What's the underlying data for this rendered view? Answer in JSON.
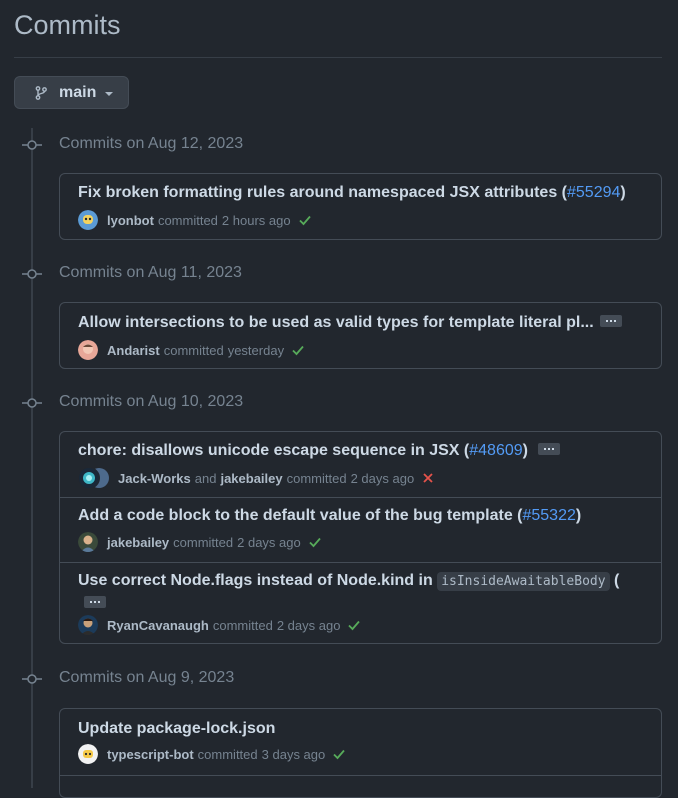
{
  "page": {
    "title": "Commits"
  },
  "branch": {
    "name": "main"
  },
  "groups": [
    {
      "date_label": "Commits on Aug 12, 2023",
      "commits": [
        {
          "message": "Fix broken formatting rules around namespaced JSX attributes (",
          "pr": "#55294",
          "message_end": ")",
          "author": "lyonbot",
          "verb": "committed",
          "time": "2 hours ago",
          "status": "success"
        }
      ]
    },
    {
      "date_label": "Commits on Aug 11, 2023",
      "commits": [
        {
          "message": "Allow intersections to be used as valid types for template literal pl...",
          "author": "Andarist",
          "verb": "committed",
          "time": "yesterday",
          "status": "success"
        }
      ]
    },
    {
      "date_label": "Commits on Aug 10, 2023",
      "commits": [
        {
          "message": "chore: disallows unicode escape sequence in JSX (",
          "pr": "#48609",
          "message_end": ")",
          "author": "Jack-Works",
          "conj": "and",
          "coauthor": "jakebailey",
          "verb": "committed",
          "time": "2 days ago",
          "status": "failure"
        },
        {
          "message": "Add a code block to the default value of the bug template (",
          "pr": "#55322",
          "message_end": ")",
          "author": "jakebailey",
          "verb": "committed",
          "time": "2 days ago",
          "status": "success"
        },
        {
          "message": "Use correct Node.flags instead of Node.kind in ",
          "code": "isInsideAwaitableBody",
          "message_end": " (",
          "author": "RyanCavanaugh",
          "verb": "committed",
          "time": "2 days ago",
          "status": "success"
        }
      ]
    },
    {
      "date_label": "Commits on Aug 9, 2023",
      "commits": [
        {
          "message": "Update package-lock.json",
          "author": "typescript-bot",
          "verb": "committed",
          "time": "3 days ago",
          "status": "success"
        }
      ]
    }
  ],
  "colors": {
    "background": "#22272e",
    "border": "#444c56",
    "link": "#539bf5",
    "success": "#57ab5a",
    "failure": "#e5534b"
  }
}
